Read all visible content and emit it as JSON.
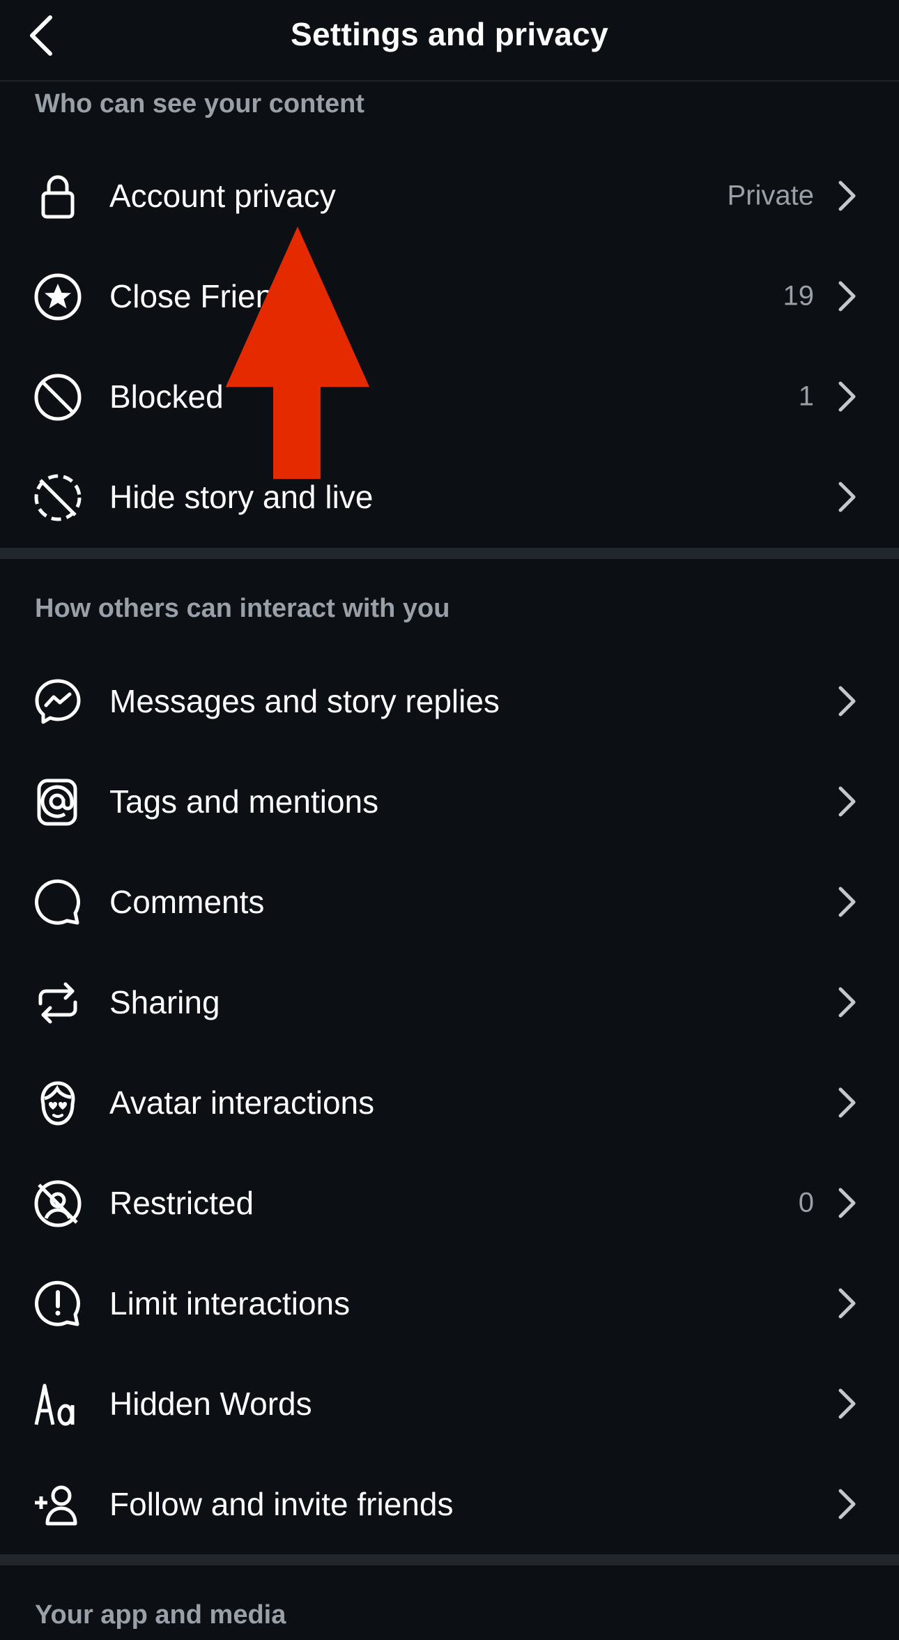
{
  "header": {
    "title": "Settings and privacy",
    "back_icon": "chevron-left-icon"
  },
  "sections": [
    {
      "heading": "Who can see your content",
      "items": [
        {
          "label": "Account privacy",
          "value": "Private",
          "icon": "lock-icon"
        },
        {
          "label": "Close Friends",
          "value": "19",
          "icon": "star-circle-icon"
        },
        {
          "label": "Blocked",
          "value": "1",
          "icon": "block-icon"
        },
        {
          "label": "Hide story and live",
          "value": "",
          "icon": "hide-story-icon"
        }
      ]
    },
    {
      "heading": "How others can interact with you",
      "items": [
        {
          "label": "Messages and story replies",
          "value": "",
          "icon": "messenger-icon"
        },
        {
          "label": "Tags and mentions",
          "value": "",
          "icon": "at-sign-icon"
        },
        {
          "label": "Comments",
          "value": "",
          "icon": "comment-bubble-icon"
        },
        {
          "label": "Sharing",
          "value": "",
          "icon": "repost-icon"
        },
        {
          "label": "Avatar interactions",
          "value": "",
          "icon": "avatar-face-icon"
        },
        {
          "label": "Restricted",
          "value": "0",
          "icon": "restricted-icon"
        },
        {
          "label": "Limit interactions",
          "value": "",
          "icon": "alert-bubble-icon"
        },
        {
          "label": "Hidden Words",
          "value": "",
          "icon": "text-aa-icon"
        },
        {
          "label": "Follow and invite friends",
          "value": "",
          "icon": "add-person-icon"
        }
      ]
    },
    {
      "heading": "Your app and media",
      "items": []
    }
  ],
  "annotation": {
    "arrow_color": "#e62a00",
    "arrow_icon": "red-up-arrow-annotation"
  },
  "colors": {
    "background": "#0c0f14",
    "secondary_text": "#9aa0a8",
    "divider": "#22262d"
  }
}
